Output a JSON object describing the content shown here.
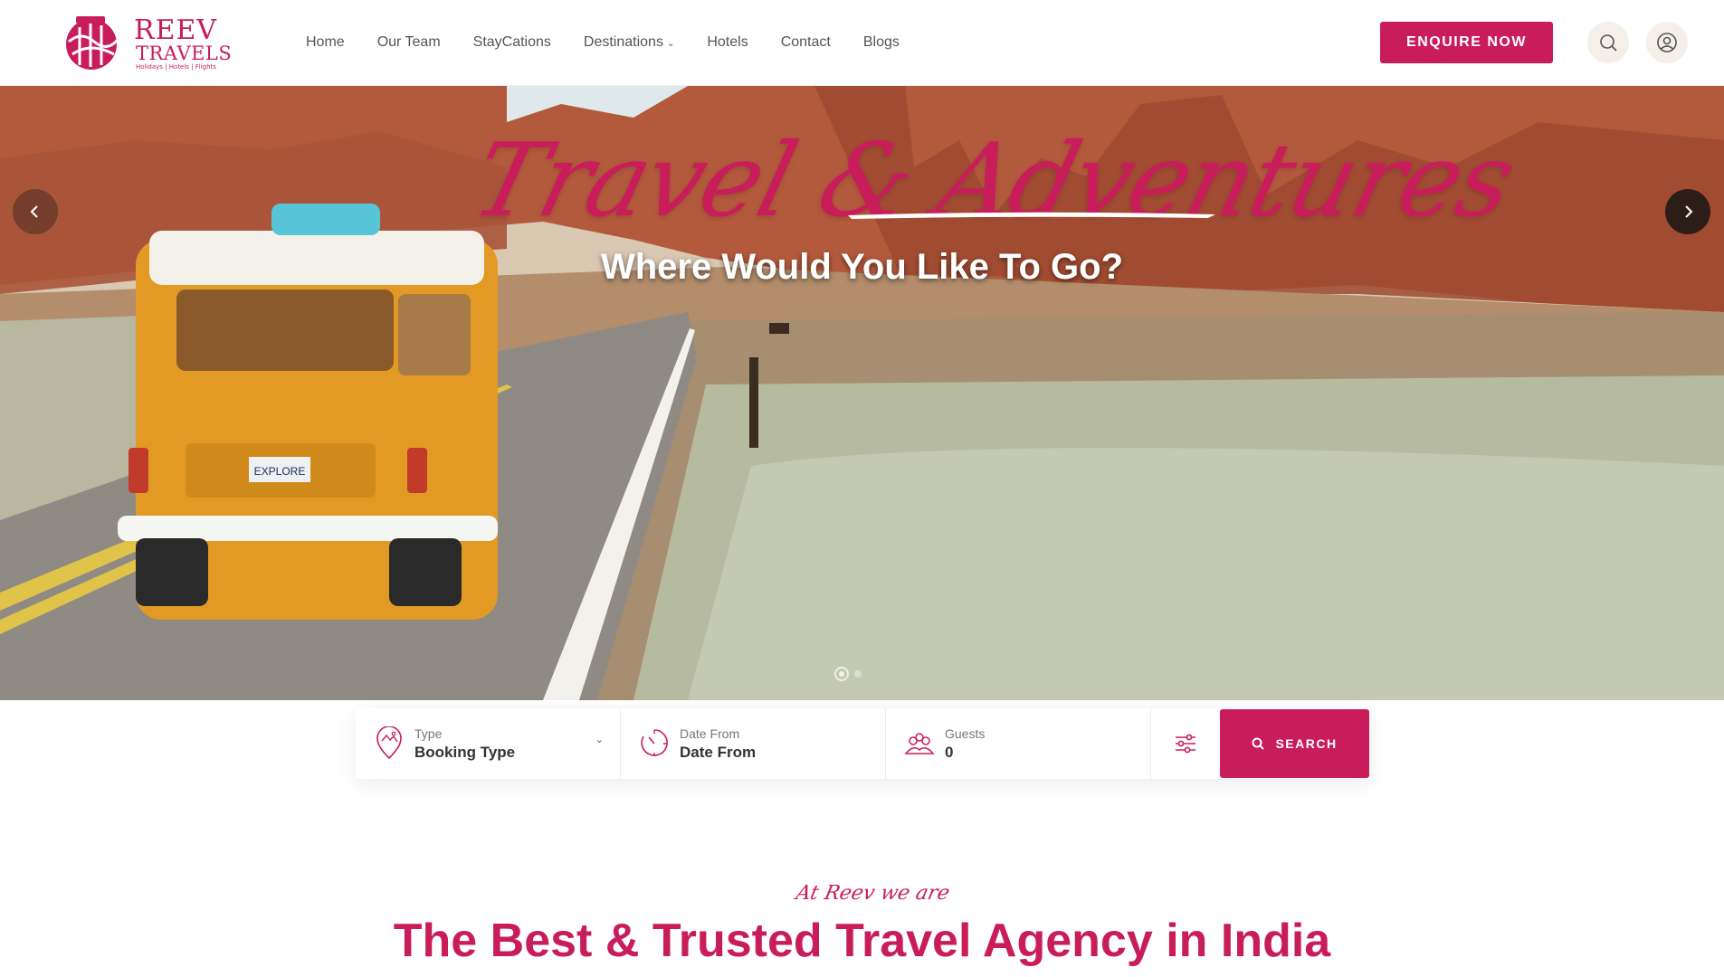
{
  "brand": {
    "name_line1": "REEV",
    "name_line2": "TRAVELS",
    "tagline": "Holidays | Hotels | Flights"
  },
  "nav": {
    "items": [
      {
        "label": "Home"
      },
      {
        "label": "Our Team"
      },
      {
        "label": "StayCations"
      },
      {
        "label": "Destinations",
        "has_dropdown": true
      },
      {
        "label": "Hotels"
      },
      {
        "label": "Contact"
      },
      {
        "label": "Blogs"
      }
    ],
    "cta_label": "ENQUIRE NOW"
  },
  "hero": {
    "script_title": "Travel & Adventures",
    "subtitle": "Where Would You Like To Go?",
    "van_plate": "EXPLORE"
  },
  "booking": {
    "type": {
      "label": "Type",
      "value": "Booking Type"
    },
    "date": {
      "label": "Date From",
      "value": "Date From"
    },
    "guests": {
      "label": "Guests",
      "value": "0"
    },
    "search_label": "SEARCH"
  },
  "intro": {
    "script": "At Reev we are",
    "title": "The Best & Trusted Travel Agency in India"
  },
  "colors": {
    "accent": "#c81d5a",
    "icon_bg": "#f5efea"
  },
  "icons": {
    "search": "search-icon",
    "user": "user-icon",
    "prev": "chevron-left-icon",
    "next": "chevron-right-icon",
    "location": "map-pin-icon",
    "clock": "clock-icon",
    "guests": "group-icon",
    "filter": "sliders-icon"
  }
}
